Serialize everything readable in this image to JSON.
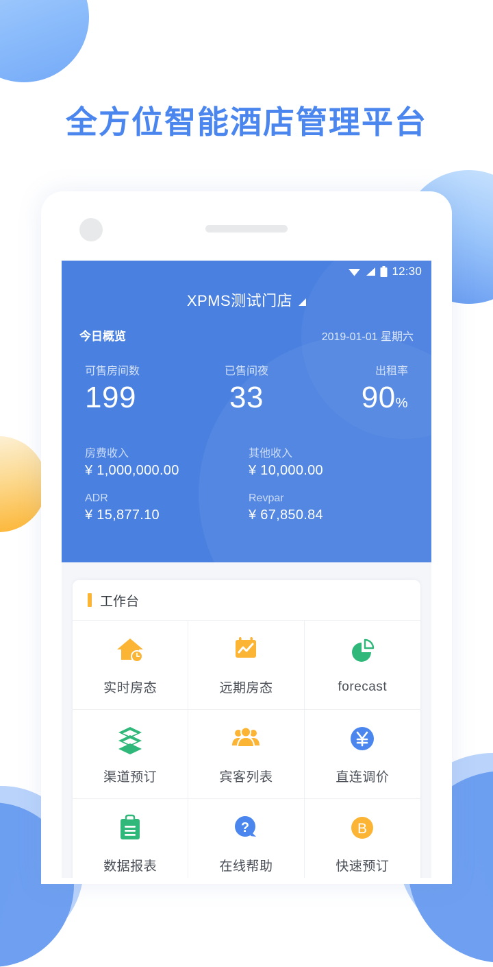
{
  "headline": "全方位智能酒店管理平台",
  "phone": {
    "camera_icon": "camera-dot",
    "speaker_icon": "earpiece-speaker"
  },
  "statusbar": {
    "wifi_icon": "wifi-icon",
    "signal_icon": "signal-icon",
    "battery_icon": "battery-icon",
    "time": "12:30"
  },
  "header": {
    "hotel_name": "XPMS测试门店",
    "dropdown_icon": "triangle-down-icon",
    "overview_title": "今日概览",
    "overview_date": "2019-01-01 星期六",
    "bg_color": "#4a80e0"
  },
  "kpis": [
    {
      "label": "可售房间数",
      "value": "199",
      "unit": ""
    },
    {
      "label": "已售间夜",
      "value": "33",
      "unit": ""
    },
    {
      "label": "出租率",
      "value": "90",
      "unit": "%"
    }
  ],
  "money": [
    {
      "label": "房费收入",
      "value": "¥ 1,000,000.00"
    },
    {
      "label": "其他收入",
      "value": "¥ 10,000.00"
    },
    {
      "label": "ADR",
      "value": "¥ 15,877.10"
    },
    {
      "label": "Revpar",
      "value": "¥ 67,850.84"
    }
  ],
  "workbench": {
    "title": "工作台",
    "accent_color": "#fcb434",
    "items": [
      {
        "label": "实时房态",
        "icon": "house-clock-icon",
        "color": "#fcb434"
      },
      {
        "label": "远期房态",
        "icon": "calendar-chart-icon",
        "color": "#fcb434"
      },
      {
        "label": "forecast",
        "icon": "pie-chart-icon",
        "color": "#2fb87a"
      },
      {
        "label": "渠道预订",
        "icon": "layers-icon",
        "color": "#2fb87a"
      },
      {
        "label": "宾客列表",
        "icon": "users-icon",
        "color": "#fcb434"
      },
      {
        "label": "直连调价",
        "icon": "yen-circle-icon",
        "color": "#4a86ee"
      },
      {
        "label": "数据报表",
        "icon": "clipboard-icon",
        "color": "#2fb87a"
      },
      {
        "label": "在线帮助",
        "icon": "question-bubble-icon",
        "color": "#4a86ee"
      },
      {
        "label": "快速预订",
        "icon": "b-circle-icon",
        "color": "#fcb434"
      }
    ]
  }
}
